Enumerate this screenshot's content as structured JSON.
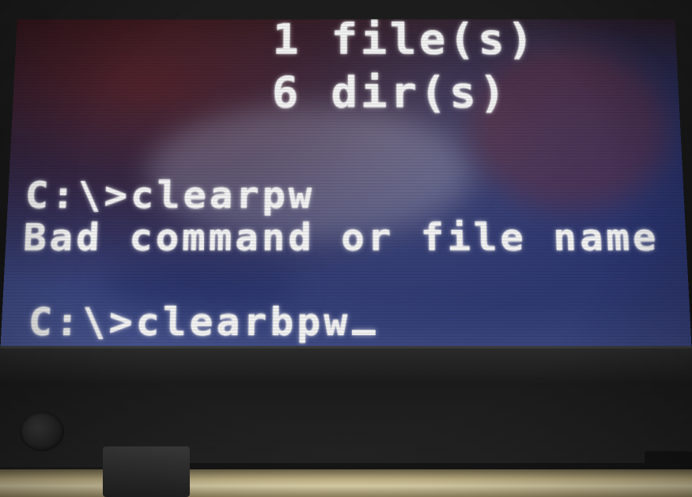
{
  "terminal": {
    "lines": [
      "1 file(s)",
      "6 dir(s)",
      "C:\\>clearpw",
      "Bad command or file name",
      "C:\\>clearbpw"
    ]
  },
  "colors": {
    "screen_background": "#3a4680",
    "text": "#f2f2f2",
    "bezel": "#1b1b1b"
  },
  "icons": {
    "cursor": "block-underscore-cursor",
    "power_led": "led-icon"
  }
}
